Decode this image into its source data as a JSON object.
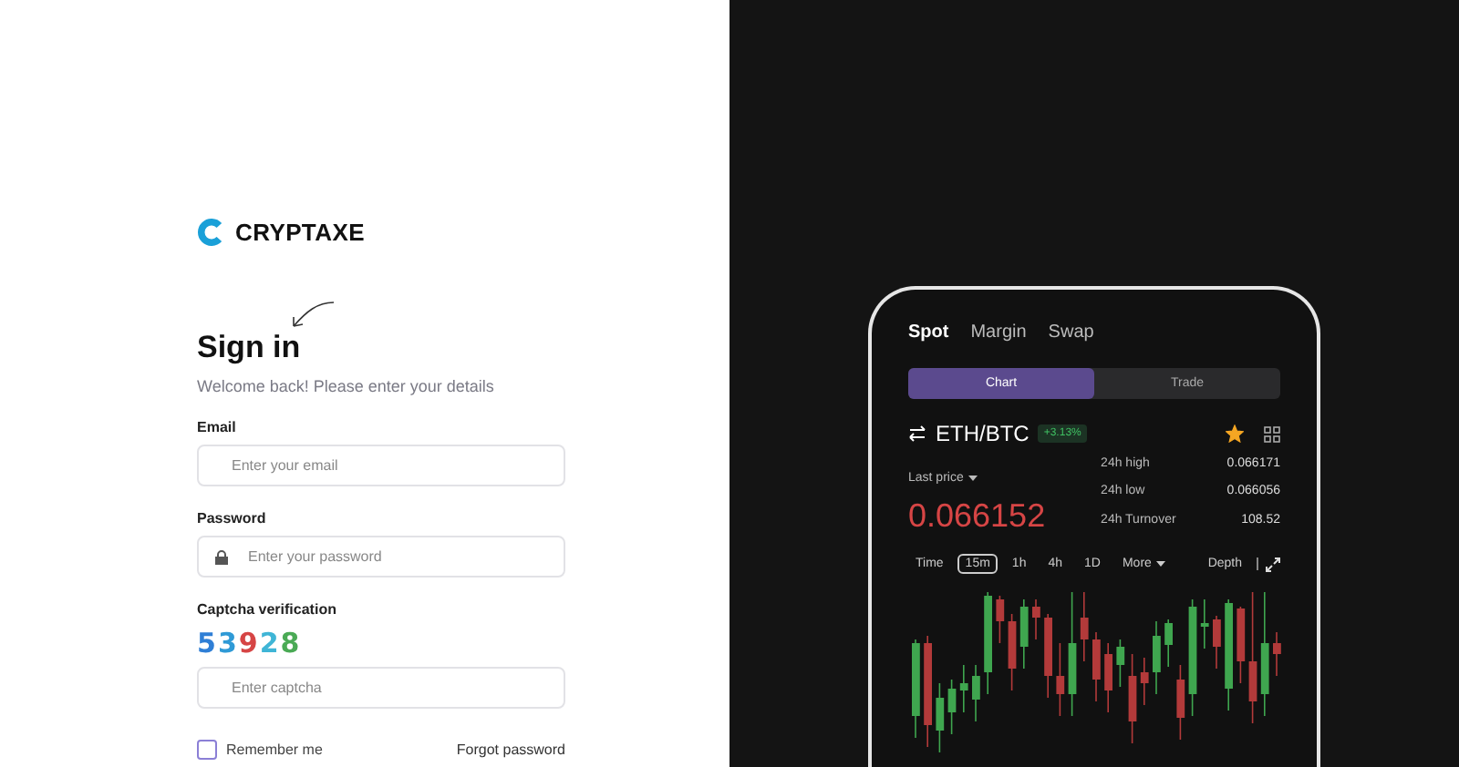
{
  "brand": {
    "name": "CRYPTAXE"
  },
  "heading": "Sign in",
  "subtitle": "Welcome back! Please enter your details",
  "fields": [
    {
      "label": "Email",
      "placeholder": "Enter your email",
      "kind": "email"
    },
    {
      "label": "Password",
      "placeholder": "Enter your password",
      "kind": "password"
    }
  ],
  "captcha": {
    "label": "Captcha verification",
    "code": "53928",
    "placeholder": "Enter captcha"
  },
  "remember": {
    "label": "Remember me",
    "checked": false
  },
  "forgot_link": "Forgot password",
  "phone": {
    "market_tabs": [
      {
        "label": "Spot",
        "selected": true
      },
      {
        "label": "Margin",
        "selected": false
      },
      {
        "label": "Swap",
        "selected": false
      }
    ],
    "view_tabs": [
      {
        "label": "Chart",
        "selected": true
      },
      {
        "label": "Trade",
        "selected": false
      }
    ],
    "pair": "ETH/BTC",
    "change": "+3.13%",
    "favorite": true,
    "last_price_label": "Last price",
    "last_price": "0.066152",
    "stats": [
      {
        "label": "24h high",
        "value": "0.066171"
      },
      {
        "label": "24h low",
        "value": "0.066056"
      },
      {
        "label": "24h Turnover",
        "value": "108.52"
      }
    ],
    "intervals": [
      {
        "label": "Time",
        "selected": false
      },
      {
        "label": "15m",
        "selected": true
      },
      {
        "label": "1h",
        "selected": false
      },
      {
        "label": "4h",
        "selected": false
      },
      {
        "label": "1D",
        "selected": false
      }
    ],
    "more": "More",
    "depth": "Depth"
  }
}
